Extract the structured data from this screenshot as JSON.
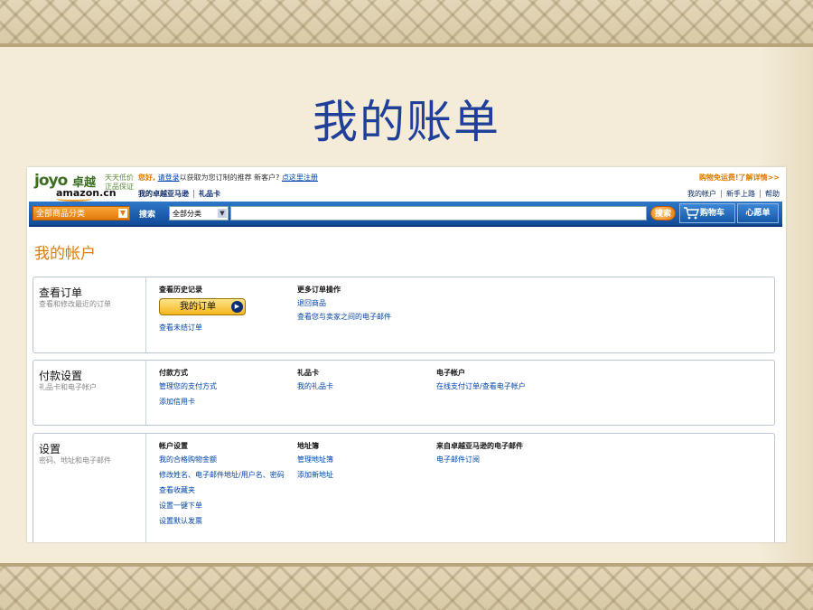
{
  "slide": {
    "title": "我的账单"
  },
  "header": {
    "logo": {
      "joyo": "joyo",
      "zhuoyue": "卓越",
      "amazon": "amazon.cn",
      "slogan": "天天低价 正品保证"
    },
    "greeting": {
      "hello": "您好,",
      "login_link": "请登录",
      "mid_text": "以获取为您订制的推荐 新客户?",
      "register_link": "点这里注册"
    },
    "subnav": [
      "我的卓越亚马逊",
      "礼品卡"
    ],
    "promo": "购物免运费!了解详情>>",
    "top_links": [
      "我的帐户",
      "新手上路",
      "帮助"
    ]
  },
  "search_bar": {
    "category_dropdown": "全部商品分类",
    "search_label": "搜索",
    "scope_select": "全部分类",
    "query": "",
    "search_button": "搜索",
    "cart_button": "购物车",
    "wishlist_button": "心愿单"
  },
  "page": {
    "title": "我的帐户"
  },
  "sections": {
    "orders": {
      "title": "查看订单",
      "desc": "查看和修改最近的订单",
      "history": {
        "heading": "查看历史记录",
        "button": "我的订单",
        "links": [
          "查看未结订单"
        ]
      },
      "more": {
        "heading": "更多订单操作",
        "links": [
          "退回商品",
          "查看您与卖家之间的电子邮件"
        ]
      }
    },
    "payment": {
      "title": "付款设置",
      "desc": "礼品卡和电子帐户",
      "methods": {
        "heading": "付款方式",
        "links": [
          "管理您的支付方式",
          "添加信用卡"
        ]
      },
      "giftcard": {
        "heading": "礼品卡",
        "links": [
          "我的礼品卡"
        ]
      },
      "eaccount": {
        "heading": "电子帐户",
        "links": [
          "在线支付订单/查看电子帐户"
        ]
      }
    },
    "settings": {
      "title": "设置",
      "desc": "密码、地址和电子邮件",
      "account": {
        "heading": "帐户设置",
        "links": [
          "我的合格购物金额",
          "修改姓名、电子邮件地址/用户名、密码",
          "查看收藏夹",
          "设置一键下单",
          "设置默认发票"
        ]
      },
      "address": {
        "heading": "地址簿",
        "links": [
          "管理地址簿",
          "添加新地址"
        ]
      },
      "email": {
        "heading": "来自卓越亚马逊的电子邮件",
        "links": [
          "电子邮件订阅"
        ]
      }
    }
  }
}
